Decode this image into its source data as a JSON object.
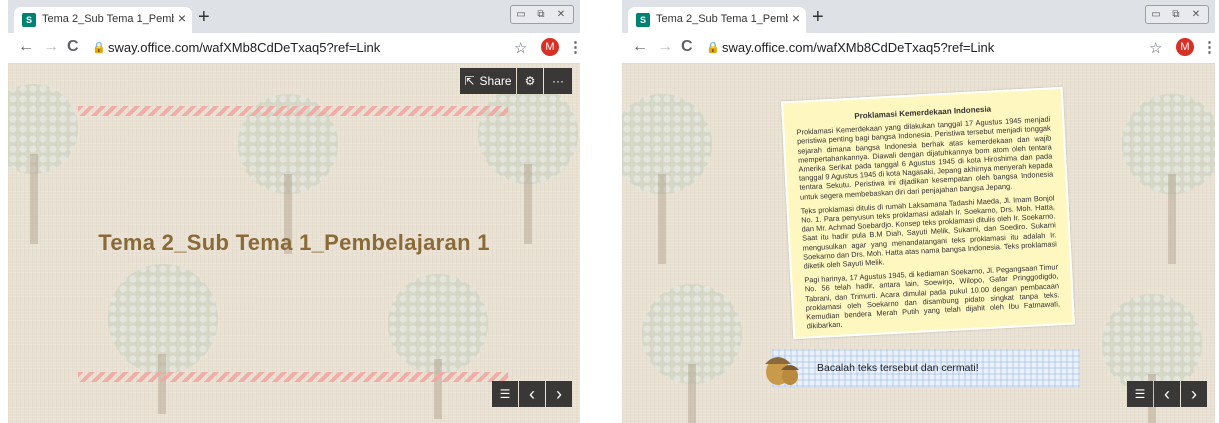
{
  "browser": {
    "tab_title": "Tema 2_Sub Tema 1_Pembelajara",
    "tab_favicon": "S",
    "tab_close": "×",
    "new_tab": "+",
    "url": "sway.office.com/wafXMb8CdDeTxaq5?ref=Link",
    "avatar_letter": "M",
    "back_icon": "←",
    "forward_icon": "→",
    "reload_icon": "C",
    "lock_icon": "🔒",
    "star_icon": "☆",
    "menu_icon": "⋮",
    "win_min": "▭",
    "win_max": "⧉",
    "win_close": "✕"
  },
  "left_slide": {
    "title": "Tema 2_Sub Tema 1_Pembelajaran 1",
    "share_label": "Share",
    "settings_icon": "⚙",
    "more_icon": "···",
    "list_icon": "☰",
    "prev_icon": "‹",
    "next_icon": "›"
  },
  "right_slide": {
    "note_title": "Proklamasi Kemerdekaan Indonesia",
    "paragraphs": [
      "Proklamasi Kemerdekaan yang dilakukan tanggal 17 Agustus 1945 menjadi peristiwa penting bagi bangsa Indonesia. Peristiwa tersebut menjadi tonggak sejarah dimana bangsa Indonesia berhak atas kemerdekaan dan wajib mempertahankannya. Diawali dengan dijatuhkannya bom atom oleh tentara Amerika Serikat pada tanggal 6 Agustus 1945 di kota Hiroshima dan pada tanggal 9 Agustus 1945 di kota Nagasaki, Jepang akhirnya menyerah kepada tentara Sekutu. Peristiwa ini dijadikan kesempatan oleh bangsa Indonesia untuk segera membebaskan diri dari penjajahan bangsa Jepang.",
      "Teks proklamasi ditulis di rumah Laksamana Tadashi Maeda, Jl. Imam Bonjol No. 1. Para penyusun teks proklamasi adalah Ir. Soekarno, Drs. Moh. Hatta, dan Mr. Achmad Soebardjo. Konsep teks proklamasi ditulis oleh Ir. Soekarno. Saat itu hadir pula B.M Diah, Sayuti Melik, Sukarni, dan Soediro. Sukarni mengusulkan agar yang menandatangani teks proklamasi itu adalah Ir. Soekarno dan Drs. Moh. Hatta atas nama bangsa Indonesia. Teks proklamasi diketik oleh Sayuti Melik.",
      "Pagi harinya, 17 Agustus 1945, di kediaman Soekarno, Jl. Pegangsaan Timur No. 56 telah hadir, antara lain, Soewirjo, Wilopo, Gafar Pringgodigdo, Tabrani, dan Trimurti. Acara dimulai pada pukul 10.00 dengan pembacaan proklamasi oleh Soekarno dan disambung pidato singkat tanpa teks. Kemudian bendera Merah Putih yang telah dijahit oleh Ibu Fatmawati, dikibarkan."
    ],
    "banner_text": "Bacalah teks tersebut dan cermati!",
    "list_icon": "☰",
    "prev_icon": "‹",
    "next_icon": "›"
  }
}
